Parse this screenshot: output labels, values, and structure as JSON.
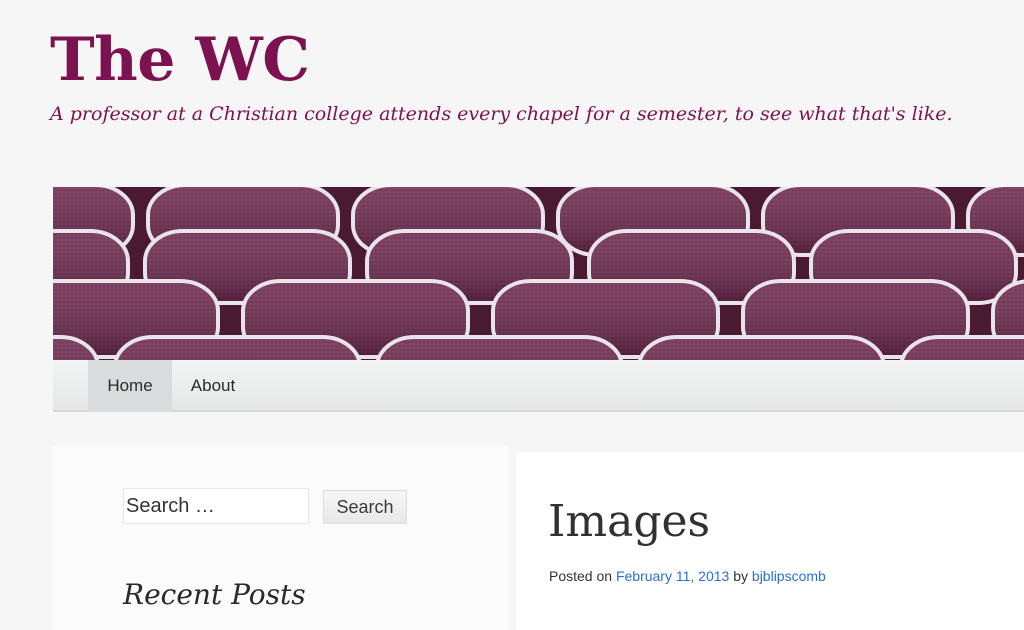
{
  "site": {
    "title": "The WC",
    "tagline": "A professor at a Christian college attends every chapel for a semester, to see what that's like."
  },
  "header_image": {
    "description_icon": "auditorium-seats-image",
    "seat_color": "#6e2a4f"
  },
  "nav": {
    "items": [
      {
        "label": "Home",
        "active": true
      },
      {
        "label": "About",
        "active": false
      }
    ]
  },
  "sidebar": {
    "search": {
      "placeholder": "Search …",
      "button_label": "Search"
    },
    "recent_posts_title": "Recent Posts"
  },
  "post": {
    "title": "Images",
    "posted_on_label": "Posted on",
    "date": "February 11, 2013",
    "by_label": "by",
    "author": "bjblipscomb"
  },
  "colors": {
    "brand": "#7c1250",
    "link": "#2a6fd6",
    "nav_active_bg": "#d9dcdc"
  }
}
